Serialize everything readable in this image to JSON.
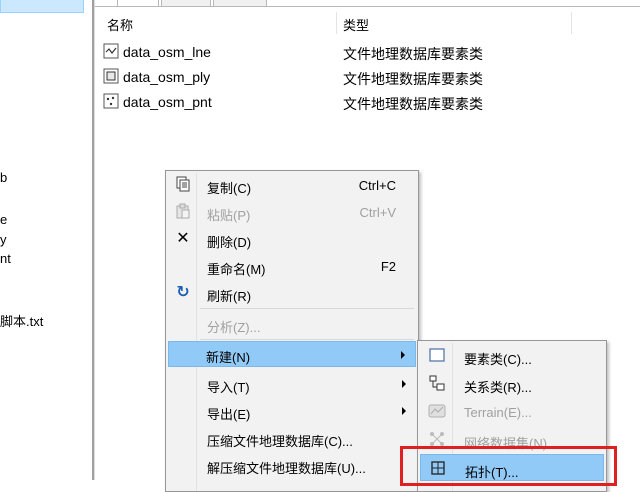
{
  "left_pane": {
    "fragments": [
      "b",
      "e",
      "y",
      "nt",
      "脚本.txt"
    ]
  },
  "columns": {
    "name": "名称",
    "type": "类型"
  },
  "rows": [
    {
      "icon": "polyline-feature-class-icon",
      "name": "data_osm_lne",
      "type": "文件地理数据库要素类"
    },
    {
      "icon": "polygon-feature-class-icon",
      "name": "data_osm_ply",
      "type": "文件地理数据库要素类"
    },
    {
      "icon": "point-feature-class-icon",
      "name": "data_osm_pnt",
      "type": "文件地理数据库要素类"
    }
  ],
  "context_menu": {
    "items": [
      {
        "label": "复制(C)",
        "shortcut": "Ctrl+C",
        "icon": "copy-icon",
        "enabled": true
      },
      {
        "label": "粘贴(P)",
        "shortcut": "Ctrl+V",
        "icon": "paste-icon",
        "enabled": false
      },
      {
        "label": "删除(D)",
        "shortcut": "",
        "icon": "delete-icon",
        "enabled": true
      },
      {
        "label": "重命名(M)",
        "shortcut": "F2",
        "icon": "",
        "enabled": true
      },
      {
        "label": "刷新(R)",
        "shortcut": "",
        "icon": "refresh-icon",
        "enabled": true
      },
      {
        "label": "分析(Z)...",
        "shortcut": "",
        "icon": "",
        "enabled": false
      },
      {
        "label": "新建(N)",
        "shortcut": "",
        "icon": "",
        "enabled": true,
        "submenu": true,
        "highlighted": true
      },
      {
        "label": "导入(T)",
        "shortcut": "",
        "icon": "",
        "enabled": true,
        "submenu": true
      },
      {
        "label": "导出(E)",
        "shortcut": "",
        "icon": "",
        "enabled": true,
        "submenu": true
      },
      {
        "label": "压缩文件地理数据库(C)...",
        "shortcut": "",
        "icon": "",
        "enabled": true
      },
      {
        "label": "解压缩文件地理数据库(U)...",
        "shortcut": "",
        "icon": "",
        "enabled": true
      }
    ]
  },
  "new_submenu": {
    "items": [
      {
        "label": "要素类(C)...",
        "icon": "feature-class-icon",
        "enabled": true
      },
      {
        "label": "关系类(R)...",
        "icon": "relationship-class-icon",
        "enabled": true
      },
      {
        "label": "Terrain(E)...",
        "icon": "terrain-icon",
        "enabled": false
      },
      {
        "label": "网络数据集(N)...",
        "icon": "network-dataset-icon",
        "enabled": false
      },
      {
        "label": "拓扑(T)...",
        "icon": "topology-icon",
        "enabled": true,
        "highlighted": true
      }
    ]
  },
  "colors": {
    "highlight": "#91c9f7",
    "annotation_box": "#e02020"
  }
}
